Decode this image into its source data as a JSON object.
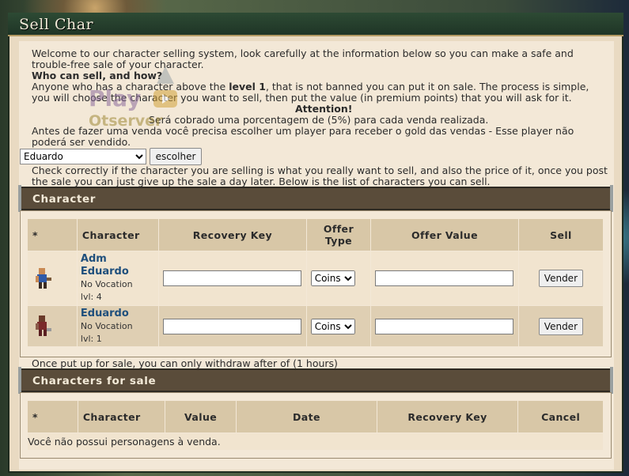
{
  "window": {
    "title": "Sell Char"
  },
  "intro": {
    "line1": "Welcome to our character selling system, look carefully at the information below so you can make a safe and",
    "line2": "trouble-free sale of your character.",
    "q_heading": "Who can sell, and how?",
    "line3a": "Anyone who has a character above the ",
    "line3b": "level 1",
    "line3c": ", that is not banned you can put it on sale. The process is simple,",
    "line4": "you will choose the character you want to sell, then put the value (in premium points) that you will ask for it.",
    "attention": "Attention!",
    "fee_line": "Será cobrado uma porcentagem de (5%) para cada venda realizada.",
    "pt_line1": "Antes de fazer uma venda você precisa escolher um player para receber o gold das vendas - Esse player não",
    "pt_line2": "poderá ser vendido."
  },
  "watermark": {
    "play": "Play",
    "otserver": "Otserver"
  },
  "receiver": {
    "selected": "Eduardo",
    "button": "escolher"
  },
  "check_text": {
    "line1": "Check correctly if the character you are selling is what you really want to sell, and also the price of it, once you post",
    "line2": "the sale you can just give up the sale a day later. Below is the list of characters you can sell."
  },
  "character_section": {
    "title": "Character",
    "headers": {
      "star": "*",
      "character": "Character",
      "recovery_key": "Recovery Key",
      "offer_type_1": "Offer",
      "offer_type_2": "Type",
      "offer_value": "Offer Value",
      "sell": "Sell"
    },
    "rows": [
      {
        "name1": "Adm",
        "name2": "Eduardo",
        "vocation": "No Vocation",
        "level": "lvl: 4",
        "offer_type": "Coins",
        "button": "Vender"
      },
      {
        "name1": "Eduardo",
        "name2": "",
        "vocation": "No Vocation",
        "level": "lvl: 1",
        "offer_type": "Coins",
        "button": "Vender"
      }
    ]
  },
  "withdraw_note": "Once put up for sale, you can only withdraw after of (1 hours)",
  "sale_section": {
    "title": "Characters for sale",
    "headers": {
      "star": "*",
      "character": "Character",
      "value": "Value",
      "date": "Date",
      "recovery_key": "Recovery Key",
      "cancel": "Cancel"
    },
    "empty": "Você não possui personagens à venda."
  },
  "colors": {
    "name_link": "#1f4f7c",
    "section_head": "#5a4c3a",
    "title_bar": "#2d4a34"
  }
}
